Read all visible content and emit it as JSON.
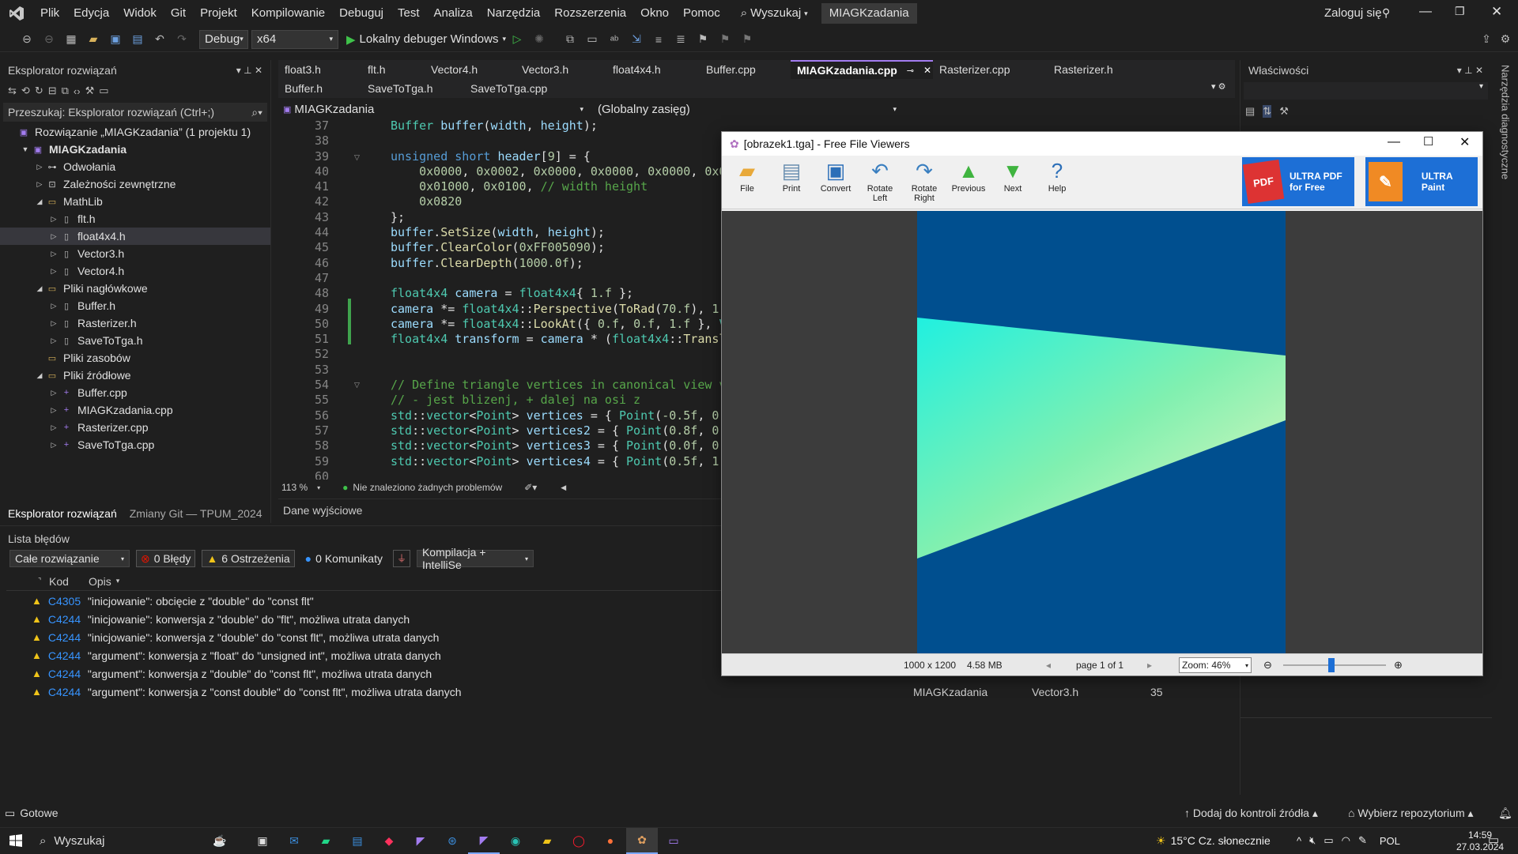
{
  "menu": [
    "Plik",
    "Edycja",
    "Widok",
    "Git",
    "Projekt",
    "Kompilowanie",
    "Debuguj",
    "Test",
    "Analiza",
    "Narzędzia",
    "Rozszerzenia",
    "Okno",
    "Pomoc"
  ],
  "search_menu": "Wyszukaj",
  "solution_title": "MIAGKzadania",
  "login": "Zaloguj się",
  "toolbar": {
    "config": "Debug",
    "platform": "x64",
    "run_label": "Lokalny debuger Windows"
  },
  "solution_explorer": {
    "title": "Eksplorator rozwiązań",
    "search_placeholder": "Przeszukaj: Eksplorator rozwiązań (Ctrl+;)",
    "items": [
      {
        "label": "Rozwiązanie „MIAGKzadania” (1 projektu 1)",
        "indent": 0,
        "arrow": "",
        "icon": "solution"
      },
      {
        "label": "MIAGKzadania",
        "indent": 1,
        "arrow": "▼",
        "icon": "project",
        "bold": true
      },
      {
        "label": "Odwołania",
        "indent": 2,
        "arrow": "▷",
        "icon": "refs"
      },
      {
        "label": "Zależności zewnętrzne",
        "indent": 2,
        "arrow": "▷",
        "icon": "deps"
      },
      {
        "label": "MathLib",
        "indent": 2,
        "arrow": "◢",
        "icon": "folder"
      },
      {
        "label": "flt.h",
        "indent": 3,
        "arrow": "▷",
        "icon": "header"
      },
      {
        "label": "float4x4.h",
        "indent": 3,
        "arrow": "▷",
        "icon": "header",
        "selected": true
      },
      {
        "label": "Vector3.h",
        "indent": 3,
        "arrow": "▷",
        "icon": "header"
      },
      {
        "label": "Vector4.h",
        "indent": 3,
        "arrow": "▷",
        "icon": "header"
      },
      {
        "label": "Pliki nagłówkowe",
        "indent": 2,
        "arrow": "◢",
        "icon": "folder"
      },
      {
        "label": "Buffer.h",
        "indent": 3,
        "arrow": "▷",
        "icon": "header"
      },
      {
        "label": "Rasterizer.h",
        "indent": 3,
        "arrow": "▷",
        "icon": "header"
      },
      {
        "label": "SaveToTga.h",
        "indent": 3,
        "arrow": "▷",
        "icon": "header"
      },
      {
        "label": "Pliki zasobów",
        "indent": 2,
        "arrow": "",
        "icon": "folder"
      },
      {
        "label": "Pliki źródłowe",
        "indent": 2,
        "arrow": "◢",
        "icon": "folder"
      },
      {
        "label": "Buffer.cpp",
        "indent": 3,
        "arrow": "▷",
        "icon": "cpp"
      },
      {
        "label": "MIAGKzadania.cpp",
        "indent": 3,
        "arrow": "▷",
        "icon": "cpp"
      },
      {
        "label": "Rasterizer.cpp",
        "indent": 3,
        "arrow": "▷",
        "icon": "cpp"
      },
      {
        "label": "SaveToTga.cpp",
        "indent": 3,
        "arrow": "▷",
        "icon": "cpp"
      }
    ],
    "bottom_tabs": [
      "Eksplorator rozwiązań",
      "Zmiany Git — TPUM_2024"
    ]
  },
  "editor": {
    "tabs_row1": [
      "float3.h",
      "flt.h",
      "Vector4.h",
      "Vector3.h",
      "float4x4.h",
      "Buffer.cpp",
      "MIAGKzadania.cpp",
      "Rasterizer.cpp",
      "Rasterizer.h"
    ],
    "active_tab": "MIAGKzadania.cpp",
    "tabs_row2": [
      "Buffer.h",
      "SaveToTga.h",
      "SaveToTga.cpp"
    ],
    "nav_project": "MIAGKzadania",
    "nav_scope": "(Globalny zasięg)",
    "zoom": "113 %",
    "status": "Nie znaleziono żadnych problemów",
    "line_numbers": [
      "37",
      "38",
      "39",
      "40",
      "41",
      "42",
      "43",
      "44",
      "45",
      "46",
      "47",
      "48",
      "49",
      "50",
      "51",
      "52",
      "53",
      "54",
      "55",
      "56",
      "57",
      "58",
      "59",
      "60"
    ]
  },
  "output": {
    "title": "Dane wyjściowe"
  },
  "errors": {
    "title": "Lista błędów",
    "scope": "Całe rozwiązanie",
    "errors_btn": "0 Błędy",
    "warnings_btn": "6 Ostrzeżenia",
    "messages_btn": "0 Komunikaty",
    "build_filter": "Kompilacja + IntelliSe",
    "col_code": "Kod",
    "col_desc": "Opis",
    "rows": [
      {
        "code": "C4305",
        "desc": "\"inicjowanie\": obcięcie z \"double\" do \"const flt\""
      },
      {
        "code": "C4244",
        "desc": "\"inicjowanie\": konwersja z \"double\" do \"flt\", możliwa utrata danych"
      },
      {
        "code": "C4244",
        "desc": "\"inicjowanie\": konwersja z \"double\" do \"const flt\", możliwa utrata danych"
      },
      {
        "code": "C4244",
        "desc": "\"argument\": konwersja z \"float\" do \"unsigned int\", możliwa utrata danych"
      },
      {
        "code": "C4244",
        "desc": "\"argument\": konwersja z \"double\" do \"const flt\", możliwa utrata danych"
      },
      {
        "code": "C4244",
        "desc": "\"argument\": konwersja z \"const double\" do \"const flt\", możliwa utrata danych"
      }
    ],
    "extra_project": "MIAGKzadania",
    "extra_file": "Vector3.h",
    "extra_line": "35"
  },
  "properties": {
    "title": "Właściwości"
  },
  "diag_tab": "Narzędzia diagnostyczne",
  "statusbar": {
    "ready": "Gotowe",
    "source": "Dodaj do kontroli źródła",
    "repo": "Wybierz repozytorium"
  },
  "viewer": {
    "title": "[obrazek1.tga] - Free File Viewers",
    "buttons": [
      {
        "label": "File",
        "icon": "folder-icon"
      },
      {
        "label": "Print",
        "icon": "print-icon"
      },
      {
        "label": "Convert",
        "icon": "convert-icon"
      },
      {
        "label": "Rotate Left",
        "icon": "rotate-left-icon"
      },
      {
        "label": "Rotate Right",
        "icon": "rotate-right-icon"
      },
      {
        "label": "Previous",
        "icon": "previous-icon"
      },
      {
        "label": "Next",
        "icon": "next-icon"
      },
      {
        "label": "Help",
        "icon": "help-icon"
      }
    ],
    "ad1": "ULTRA PDF for Free",
    "ad2": "ULTRA Paint",
    "dims": "1000 x 1200",
    "size": "4.58 MB",
    "page": "page 1 of 1",
    "zoom": "Zoom: 46%"
  },
  "taskbar": {
    "search": "Wyszukaj",
    "weather": "15°C  Cz. słonecznie",
    "lang": "POL",
    "time": "14:59",
    "date": "27.03.2024"
  },
  "colors": {
    "bg": "#1f1f1f",
    "accent": "#a37cf0",
    "warning": "#f0c419",
    "error": "#e51400",
    "image_bg": "#004f8f"
  }
}
